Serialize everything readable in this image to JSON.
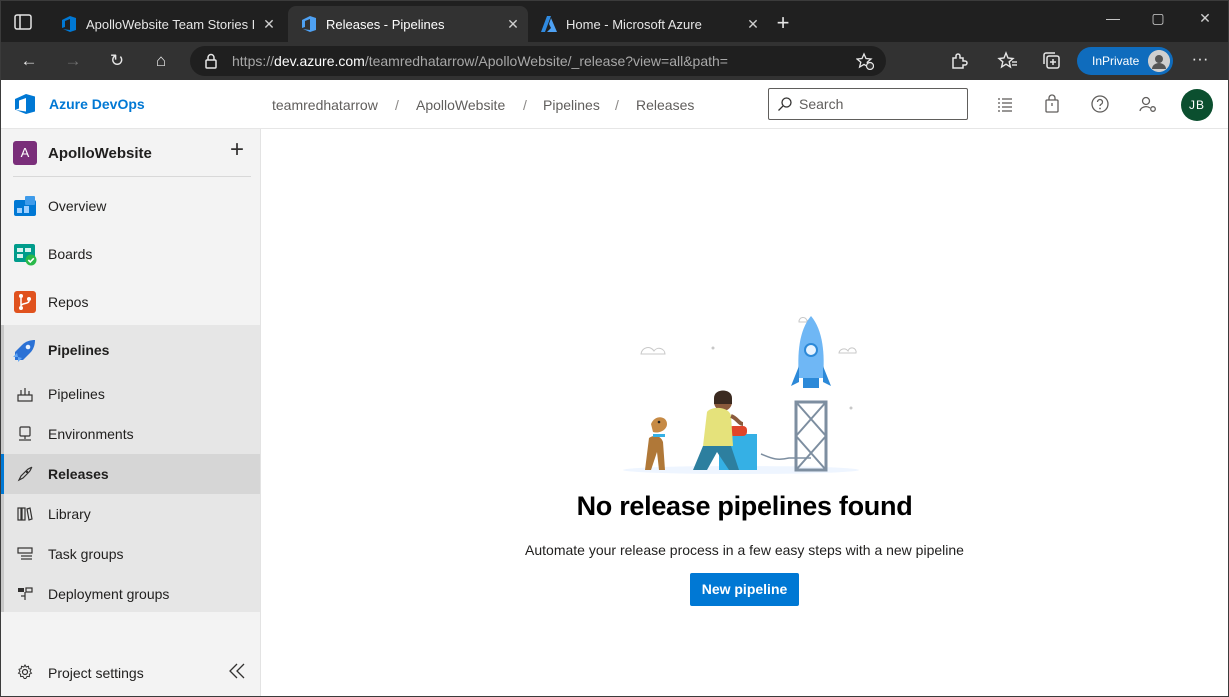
{
  "browser": {
    "tabs": [
      {
        "title": "ApolloWebsite Team Stories Boar",
        "close": "✕"
      },
      {
        "title": "Releases - Pipelines",
        "close": "✕"
      },
      {
        "title": "Home - Microsoft Azure",
        "close": "✕"
      }
    ],
    "new_tab": "+",
    "window_controls": {
      "minimize": "—",
      "maximize": "▢",
      "close": "✕"
    },
    "nav": {
      "back": "←",
      "forward": "→",
      "refresh": "↻",
      "home": "⌂",
      "more": "···"
    },
    "url_prefix": "https://",
    "url_host": "dev.azure.com",
    "url_path": "/teamredhatarrow/ApolloWebsite/_release?view=all&path=",
    "inprivate_label": "InPrivate"
  },
  "app": {
    "brand": "Azure DevOps",
    "breadcrumb": [
      "teamredhatarrow",
      "ApolloWebsite",
      "Pipelines",
      "Releases"
    ],
    "breadcrumb_sep": "/",
    "search_placeholder": "Search",
    "user_initials": "JB",
    "accent_color": "#0078d4"
  },
  "sidebar": {
    "project_initial": "A",
    "project_name": "ApolloWebsite",
    "add_label": "+",
    "items": [
      {
        "label": "Overview",
        "icon": "overview-icon"
      },
      {
        "label": "Boards",
        "icon": "boards-icon"
      },
      {
        "label": "Repos",
        "icon": "repos-icon"
      },
      {
        "label": "Pipelines",
        "icon": "pipelines-icon"
      }
    ],
    "sub_items": [
      {
        "label": "Pipelines",
        "icon": "pipeline-list-icon"
      },
      {
        "label": "Environments",
        "icon": "environments-icon"
      },
      {
        "label": "Releases",
        "icon": "releases-rocket-icon",
        "selected": true
      },
      {
        "label": "Library",
        "icon": "library-icon"
      },
      {
        "label": "Task groups",
        "icon": "task-groups-icon"
      },
      {
        "label": "Deployment groups",
        "icon": "deployment-groups-icon"
      }
    ],
    "settings_label": "Project settings"
  },
  "main": {
    "empty_title": "No release pipelines found",
    "empty_subtitle": "Automate your release process in a few easy steps with a new pipeline",
    "new_pipeline_label": "New pipeline"
  }
}
